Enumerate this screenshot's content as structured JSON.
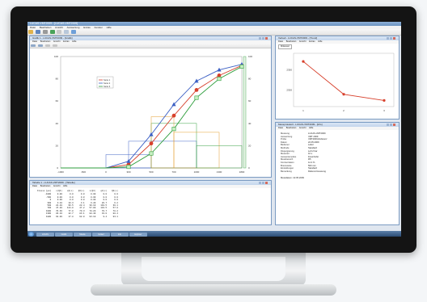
{
  "app": {
    "title": "LUCAS-VMT2009 - [LUCAS-VMT2009]",
    "menu": [
      "Datei",
      "Bearbeiten",
      "Ansicht",
      "Auswertung",
      "Extras",
      "Fenster",
      "Hilfe"
    ],
    "toolbar_icons": [
      "open-icon",
      "save-icon",
      "print-icon",
      "chart-icon",
      "table-icon",
      "cursor-icon",
      "help-icon"
    ]
  },
  "chart_window": {
    "title": "Grafik 1 - LUCAS-VMT2009 - [Grafik]",
    "menu": [
      "Datei",
      "Bearbeiten",
      "Ansicht",
      "Extras",
      "Hilfe"
    ],
    "legend_entries": [
      "Serie 1",
      "Serie 2",
      "Serie 3"
    ],
    "colors": {
      "red": "#d7402c",
      "blue": "#3b5fc4",
      "green": "#2e9e3c",
      "orange": "#e39a25",
      "gray": "#8a8a8a"
    }
  },
  "chart_data": {
    "type": "line",
    "x": [
      -1000,
      -500,
      0,
      300,
      500,
      700,
      1000,
      1300,
      1800
    ],
    "series": [
      {
        "values": [
          0,
          0,
          0,
          3,
          22,
          47,
          70,
          83,
          92
        ]
      },
      {
        "values": [
          0,
          0,
          0,
          6,
          30,
          57,
          78,
          88,
          93
        ]
      },
      {
        "values": [
          0,
          0,
          0,
          1,
          13,
          35,
          63,
          80,
          91
        ]
      }
    ],
    "xlim": [
      -1000,
      1800
    ],
    "ylim": [
      0,
      100
    ],
    "x_ticks": [
      "-1000",
      "-500",
      "0",
      "300",
      "500",
      "700",
      "1000",
      "1300",
      "1800"
    ],
    "y_ticks": [
      "100",
      "80",
      "60",
      "40",
      "20",
      "0"
    ],
    "right_ticks": [
      "100",
      "80",
      "60",
      "40",
      "20",
      "0"
    ],
    "grid": false,
    "legend": "top-left"
  },
  "table_window": {
    "title": "Tabelle 1 - LUCAS-VMT2009 - [Tabelle]",
    "menu": [
      "Datei",
      "Bearbeiten",
      "Ansicht",
      "Hilfe"
    ],
    "headers": [
      "Klasse [µm]",
      "x(Q3)",
      "q3(x)",
      "Q3(x)",
      "x(Q3)",
      "q3(x)",
      "Q3(x)"
    ],
    "rows": [
      [
        "-1000",
        "0.00",
        "0.0",
        "0.0",
        "0.00",
        "0.0",
        "0.0"
      ],
      [
        "-500",
        "0.00",
        "0.0",
        "0.0",
        "0.00",
        "0.0",
        "0.0"
      ],
      [
        "0",
        "0.00",
        "0.0",
        "0.0",
        "0.00",
        "0.0",
        "0.0"
      ],
      [
        "300",
        "3.10",
        "10.3",
        "3.1",
        "6.20",
        "20.7",
        "6.2"
      ],
      [
        "500",
        "22.40",
        "96.5",
        "22.4",
        "30.10",
        "119.5",
        "30.1"
      ],
      [
        "700",
        "47.20",
        "124.0",
        "47.2",
        "57.00",
        "134.5",
        "57.0"
      ],
      [
        "1000",
        "70.30",
        "77.0",
        "70.3",
        "78.20",
        "70.7",
        "78.2"
      ],
      [
        "1300",
        "83.10",
        "42.7",
        "83.1",
        "88.40",
        "34.0",
        "88.4"
      ],
      [
        "1800",
        "92.00",
        "17.8",
        "92.0",
        "93.10",
        "9.4",
        "93.1"
      ]
    ]
  },
  "trend_window": {
    "title": "Verlauf - LUCAS-VMT2009 - [Trend]",
    "menu": [
      "Datei",
      "Bearbeiten",
      "Ansicht",
      "Extras",
      "Hilfe"
    ],
    "selector": "Mittelwert",
    "chart_data": {
      "type": "line",
      "x": [
        1,
        2,
        3
      ],
      "series": [
        {
          "values": [
            2370,
            2290,
            2275
          ]
        }
      ],
      "x_ticks": [
        "1",
        "2",
        "3"
      ],
      "y_ticks": [
        "2350",
        "2300"
      ],
      "ylim": [
        2260,
        2390
      ]
    }
  },
  "info_window": {
    "title": "Messprotokoll - LUCAS-VMT2009 - [Info]",
    "menu": [
      "Datei",
      "Bearbeiten",
      "Ansicht",
      "Hilfe"
    ],
    "fields": [
      [
        "Messung",
        "LUCAS-VMT2009"
      ],
      [
        "Auswertung",
        "VMT 2009"
      ],
      [
        "Probe",
        "VMT2009-Referenz"
      ],
      [
        "Datum",
        "22.05.2009"
      ],
      [
        "Bediener",
        "Labor"
      ],
      [
        "Methode",
        "Standard"
      ],
      [
        "Dispergierung",
        "Luft 2 bar"
      ],
      [
        "Messzeit",
        "10 s"
      ],
      [
        "Auswertemodus",
        "Fraunhofer"
      ],
      [
        "Messbereich",
        "R5"
      ],
      [
        "Konzentration",
        "12.4 %"
      ],
      [
        "Brennweite",
        "500 mm"
      ],
      [
        "Einstellungen",
        "Standard"
      ],
      [
        "Bemerkung",
        "Referenzmessung"
      ]
    ],
    "footer": "Messdatum: 22.05.2009"
  },
  "taskbar": {
    "tasks": [
      "LUCAS",
      "Grafik",
      "Tabelle",
      "Verlauf",
      "Info",
      "Explorer"
    ]
  }
}
